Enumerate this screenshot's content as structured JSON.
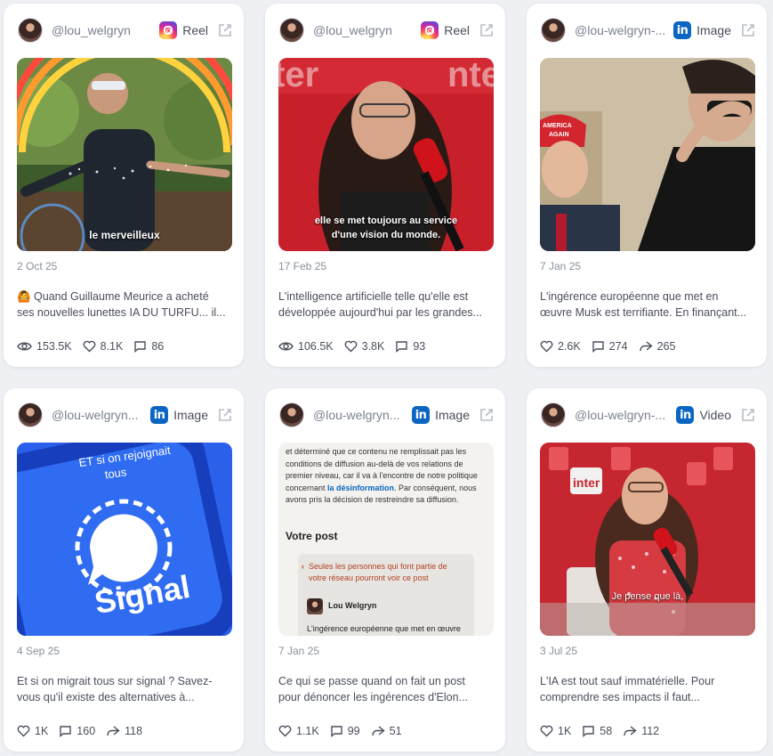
{
  "cards": [
    {
      "handle": "@lou_welgryn",
      "platform": "Instagram",
      "type_label": "Reel",
      "date": "2 Oct 25",
      "text_lines": [
        "🙆 Quand Guillaume Meurice a acheté",
        "ses nouvelles lunettes IA DU TURFU... il..."
      ],
      "caption": "le merveilleux",
      "stats": [
        {
          "icon": "eye-icon",
          "value": "153.5K"
        },
        {
          "icon": "heart-icon",
          "value": "8.1K"
        },
        {
          "icon": "comment-icon",
          "value": "86"
        }
      ]
    },
    {
      "handle": "@lou_welgryn",
      "platform": "Instagram",
      "type_label": "Reel",
      "date": "17 Feb 25",
      "text_lines": [
        "L'intelligence artificielle telle qu'elle est",
        "développée aujourd'hui par les grandes..."
      ],
      "caption_lines": [
        "elle se met toujours au service",
        "d'une vision du monde."
      ],
      "stats": [
        {
          "icon": "eye-icon",
          "value": "106.5K"
        },
        {
          "icon": "heart-icon",
          "value": "3.8K"
        },
        {
          "icon": "comment-icon",
          "value": "93"
        }
      ]
    },
    {
      "handle": "@lou-welgryn-...",
      "platform": "LinkedIn",
      "type_label": "Image",
      "date": "7 Jan 25",
      "text_lines": [
        "L'ingérence européenne que met en",
        "œuvre Musk est terrifiante. En finançant..."
      ],
      "hat_text": [
        "AMERICA",
        "AGAIN"
      ],
      "stats": [
        {
          "icon": "heart-icon",
          "value": "2.6K"
        },
        {
          "icon": "comment-icon",
          "value": "274"
        },
        {
          "icon": "share-icon",
          "value": "265"
        }
      ]
    },
    {
      "handle": "@lou-welgryn...",
      "platform": "LinkedIn",
      "type_label": "Image",
      "date": "4 Sep 25",
      "text_lines": [
        "Et si on migrait tous sur signal ? Savez-",
        "vous qu'il existe des alternatives à..."
      ],
      "overlay_lines": [
        "ET si on rejoignait",
        "tous"
      ],
      "brand": "Signal",
      "stats": [
        {
          "icon": "heart-icon",
          "value": "1K"
        },
        {
          "icon": "comment-icon",
          "value": "160"
        },
        {
          "icon": "share-icon",
          "value": "118"
        }
      ]
    },
    {
      "handle": "@lou-welgryn...",
      "platform": "LinkedIn",
      "type_label": "Image",
      "date": "7 Jan 25",
      "text_lines": [
        "Ce qui se passe quand on fait un post",
        "pour dénoncer les ingérences d'Elon..."
      ],
      "doc": {
        "paragraph_before": "et déterminé que ce contenu ne remplissait pas les conditions de diffusion au-delà de vos relations de premier niveau, car il va à l'encontre de notre politique concernant ",
        "link": "la désinformation",
        "paragraph_after": ". Par conséquent, nous avons pris la décision de restreindre sa diffusion.",
        "section_title": "Votre post",
        "warning": "Seules les personnes qui font partie de votre réseau pourront voir ce post",
        "author": "Lou Welgryn",
        "post_excerpt": "L'ingérence européenne que met en œuvre"
      },
      "stats": [
        {
          "icon": "heart-icon",
          "value": "1.1K"
        },
        {
          "icon": "comment-icon",
          "value": "99"
        },
        {
          "icon": "share-icon",
          "value": "51"
        }
      ]
    },
    {
      "handle": "@lou-welgryn-...",
      "platform": "LinkedIn",
      "type_label": "Video",
      "date": "3 Jul 25",
      "text_lines": [
        "L'IA est tout sauf immatérielle. Pour",
        "comprendre ses impacts il faut..."
      ],
      "caption": "Je pense que là,",
      "logo_text": "inter",
      "stats": [
        {
          "icon": "heart-icon",
          "value": "1K"
        },
        {
          "icon": "comment-icon",
          "value": "58"
        },
        {
          "icon": "share-icon",
          "value": "112"
        }
      ]
    }
  ],
  "colors": {
    "background": "#eef0f4",
    "card": "#ffffff",
    "linkedin_blue": "#0a66c2",
    "muted_text": "#8a909c"
  }
}
